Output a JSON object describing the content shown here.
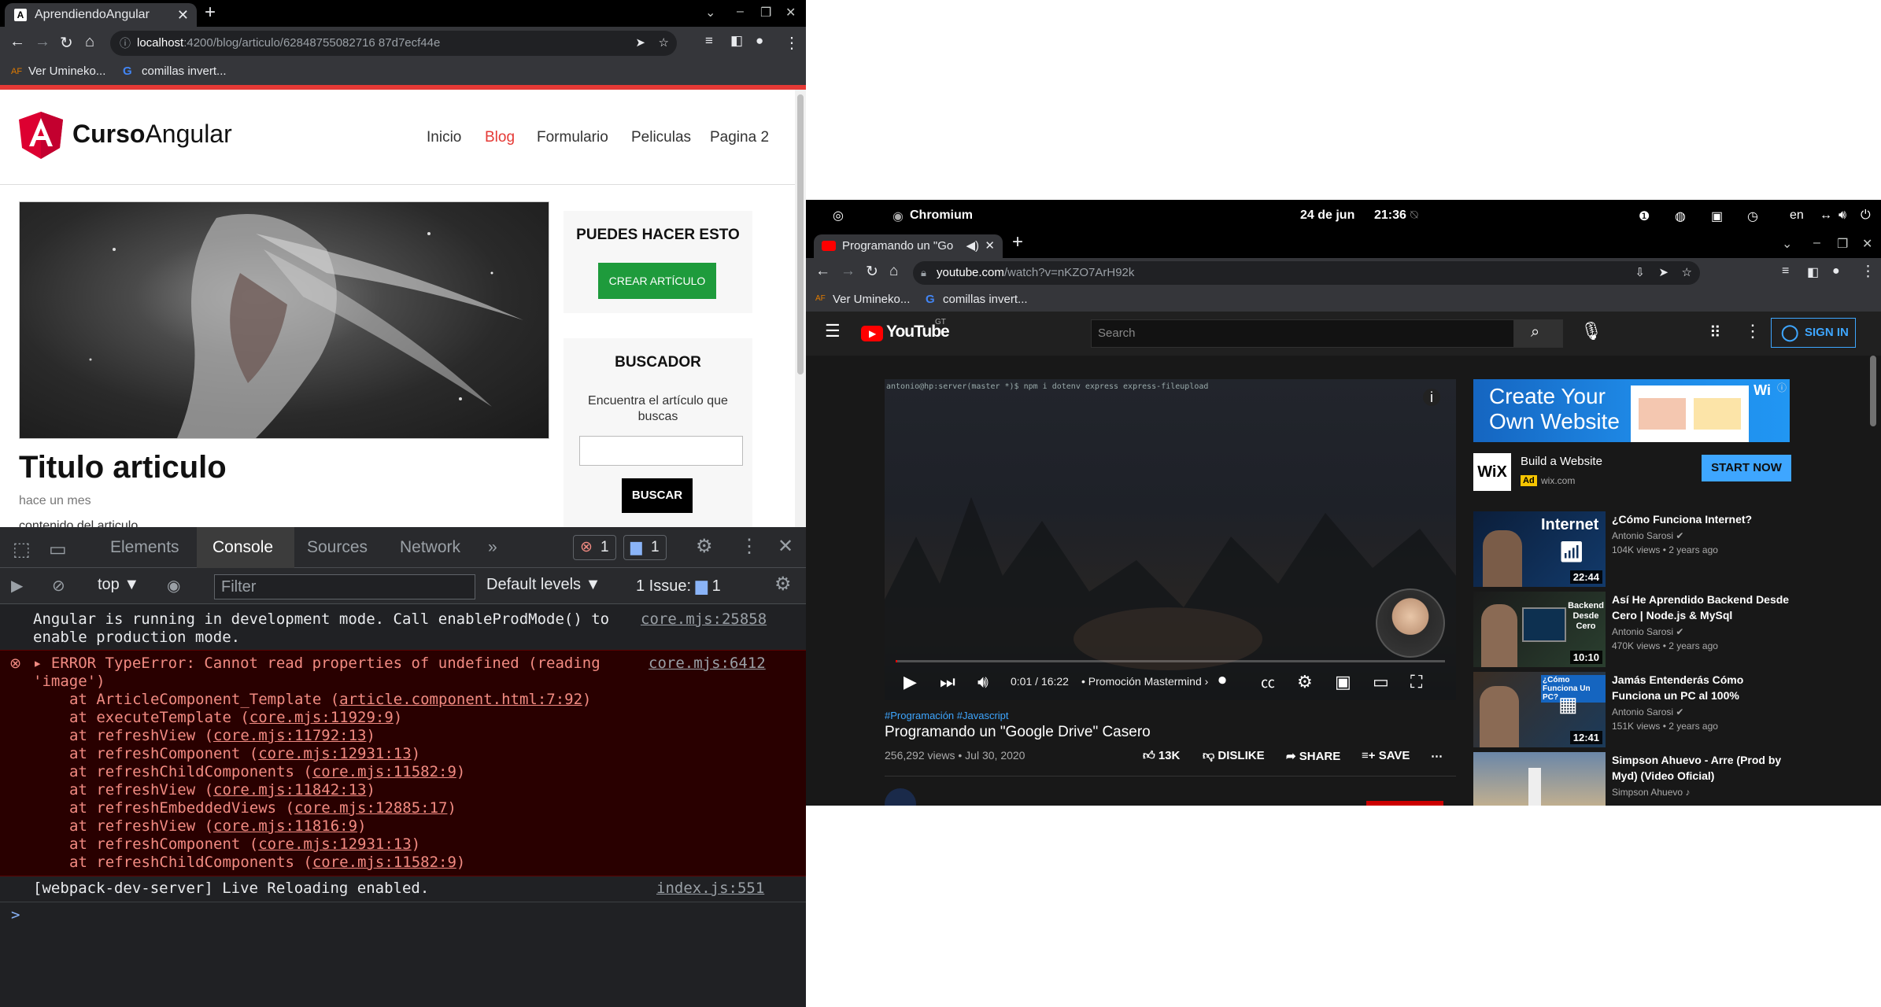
{
  "left": {
    "tab_title": "AprendiendoAngular",
    "url_host": "localhost",
    "url_path": ":4200/blog/articulo/62848755082716 87d7ecf44e",
    "bookmarks": [
      "Ver Umineko...",
      "comillas invert..."
    ],
    "site": {
      "name_bold": "Curso",
      "name_rest": "Angular"
    },
    "nav": [
      "Inicio",
      "Blog",
      "Formulario",
      "Peliculas",
      "Pagina 2"
    ],
    "article": {
      "title": "Titulo articulo",
      "date": "hace un mes",
      "more": "contenido del articulo"
    },
    "box1": {
      "heading": "PUEDES HACER ESTO",
      "button": "CREAR ARTÍCULO"
    },
    "box2": {
      "heading": "BUSCADOR",
      "desc": "Encuentra el artículo que buscas",
      "button": "BUSCAR"
    },
    "devtools": {
      "tabs": [
        "Elements",
        "Console",
        "Sources",
        "Network"
      ],
      "errors_count": "1",
      "messages_count": "1",
      "context": "top",
      "filter_placeholder": "Filter",
      "levels": "Default levels",
      "issues_label": "1 Issue:",
      "issues_count": "1",
      "info_line1": "Angular is running in development mode. Call enableProdMode() to",
      "info_line2": "enable production mode.",
      "info_link": "core.mjs:25858",
      "error_line1": "ERROR TypeError: Cannot read properties of undefined (reading",
      "error_line2": "'image')",
      "error_link": "core.mjs:6412",
      "stack": [
        {
          "fn": "at ArticleComponent_Template (",
          "loc": "article.component.html:7:92",
          "end": ")"
        },
        {
          "fn": "at executeTemplate (",
          "loc": "core.mjs:11929:9",
          "end": ")"
        },
        {
          "fn": "at refreshView (",
          "loc": "core.mjs:11792:13",
          "end": ")"
        },
        {
          "fn": "at refreshComponent (",
          "loc": "core.mjs:12931:13",
          "end": ")"
        },
        {
          "fn": "at refreshChildComponents (",
          "loc": "core.mjs:11582:9",
          "end": ")"
        },
        {
          "fn": "at refreshView (",
          "loc": "core.mjs:11842:13",
          "end": ")"
        },
        {
          "fn": "at refreshEmbeddedViews (",
          "loc": "core.mjs:12885:17",
          "end": ")"
        },
        {
          "fn": "at refreshView (",
          "loc": "core.mjs:11816:9",
          "end": ")"
        },
        {
          "fn": "at refreshComponent (",
          "loc": "core.mjs:12931:13",
          "end": ")"
        },
        {
          "fn": "at refreshChildComponents (",
          "loc": "core.mjs:11582:9",
          "end": ")"
        }
      ],
      "wds_line": "[webpack-dev-server] Live Reloading enabled.",
      "wds_link": "index.js:551",
      "prompt": ">"
    }
  },
  "right": {
    "gnome": {
      "app": "Chromium",
      "date": "24 de jun",
      "time": "21:36",
      "lang": "en"
    },
    "tab_title": "Programando un \"Go",
    "url_host": "youtube.com",
    "url_path": "/watch?v=nKZO7ArH92k",
    "bookmarks": [
      "Ver Umineko...",
      "comillas invert..."
    ],
    "yt": {
      "logo": "YouTube",
      "country": "GT",
      "search_placeholder": "Search",
      "signin": "SIGN IN"
    },
    "player": {
      "terminal_text": "antonio@hp:server(master *)$ npm i dotenv express express-fileupload",
      "time": "0:01 / 16:22",
      "chapter": "Promoción Mastermind",
      "progress": 0.001
    },
    "video": {
      "tags": "#Programación #Javascript",
      "title": "Programando un \"Google Drive\" Casero",
      "views": "256,292 views • Jul 30, 2020",
      "likes": "13K",
      "dislike": "DISLIKE",
      "share": "SHARE",
      "save": "SAVE"
    },
    "ad": {
      "banner": "Create Your Own Website",
      "title": "Build a Website",
      "badge": "Ad",
      "domain": "wix.com",
      "cta": "START NOW",
      "logo": "WiX"
    },
    "recs": [
      {
        "title": "¿Cómo Funciona Internet?",
        "channel": "Antonio Sarosi",
        "meta": "104K views • 2 years ago",
        "duration": "22:44",
        "thumb_text": "Internet"
      },
      {
        "title": "Así He Aprendido Backend Desde Cero | Node.js & MySql",
        "channel": "Antonio Sarosi",
        "meta": "470K views • 2 years ago",
        "duration": "10:10",
        "thumb_text": "Backend Desde Cero"
      },
      {
        "title": "Jamás Entenderás Cómo Funciona un PC al 100%",
        "channel": "Antonio Sarosi",
        "meta": "151K views • 2 years ago",
        "duration": "12:41",
        "thumb_text": "¿Cómo Funciona Un PC?"
      },
      {
        "title": "Simpson Ahuevo - Arre (Prod by Myd) (Video Oficial)",
        "channel": "Simpson Ahuevo",
        "meta": "",
        "duration": "",
        "thumb_text": ""
      }
    ]
  }
}
